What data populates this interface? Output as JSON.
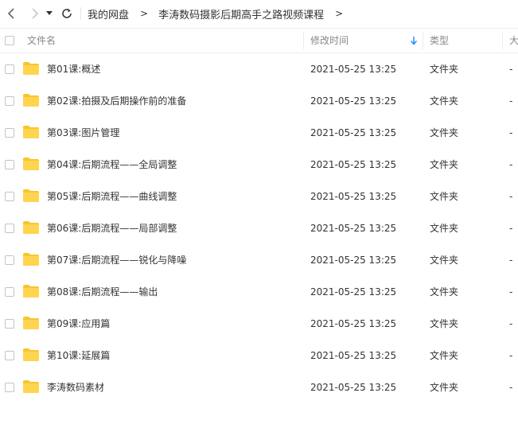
{
  "toolbar": {
    "back_icon": "chevron-left-icon",
    "forward_icon": "chevron-right-icon",
    "history_icon": "caret-down-icon",
    "refresh_icon": "refresh-icon",
    "breadcrumb": [
      {
        "label": "我的网盘"
      },
      {
        "label": "李涛数码摄影后期高手之路视频课程"
      }
    ]
  },
  "header": {
    "name": "文件名",
    "modified": "修改时间",
    "type": "类型",
    "size": "大",
    "sort_icon": "arrow-down-icon"
  },
  "files": [
    {
      "name": "第01课:概述",
      "modified": "2021-05-25 13:25",
      "type": "文件夹",
      "size": "-"
    },
    {
      "name": "第02课:拍摄及后期操作前的准备",
      "modified": "2021-05-25 13:25",
      "type": "文件夹",
      "size": "-"
    },
    {
      "name": "第03课:图片管理",
      "modified": "2021-05-25 13:25",
      "type": "文件夹",
      "size": "-"
    },
    {
      "name": "第04课:后期流程——全局调整",
      "modified": "2021-05-25 13:25",
      "type": "文件夹",
      "size": "-"
    },
    {
      "name": "第05课:后期流程——曲线调整",
      "modified": "2021-05-25 13:25",
      "type": "文件夹",
      "size": "-"
    },
    {
      "name": "第06课:后期流程——局部调整",
      "modified": "2021-05-25 13:25",
      "type": "文件夹",
      "size": "-"
    },
    {
      "name": "第07课:后期流程——锐化与降噪",
      "modified": "2021-05-25 13:25",
      "type": "文件夹",
      "size": "-"
    },
    {
      "name": "第08课:后期流程——输出",
      "modified": "2021-05-25 13:25",
      "type": "文件夹",
      "size": "-"
    },
    {
      "name": "第09课:应用篇",
      "modified": "2021-05-25 13:25",
      "type": "文件夹",
      "size": "-"
    },
    {
      "name": "第10课:延展篇",
      "modified": "2021-05-25 13:25",
      "type": "文件夹",
      "size": "-"
    },
    {
      "name": "李涛数码素材",
      "modified": "2021-05-25 13:25",
      "type": "文件夹",
      "size": "-"
    }
  ],
  "colors": {
    "folder": "#ffd54f",
    "folder_tab": "#f7c531",
    "sort_arrow": "#2a8df7"
  }
}
